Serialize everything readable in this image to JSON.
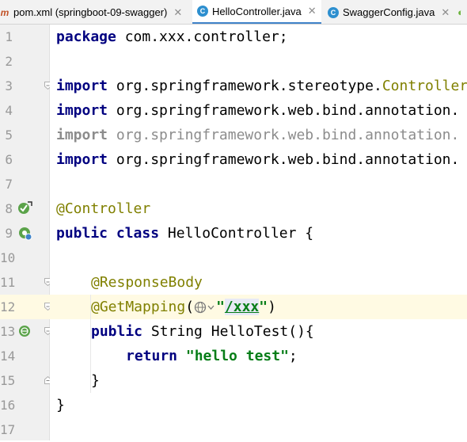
{
  "tabs": [
    {
      "label": "pom.xml (springboot-09-swagger)",
      "icon": "maven-icon",
      "active": false
    },
    {
      "label": "HelloController.java",
      "icon": "java-class-icon",
      "active": true
    },
    {
      "label": "SwaggerConfig.java",
      "icon": "java-class-icon",
      "active": false
    }
  ],
  "line_numbers": [
    "1",
    "2",
    "3",
    "4",
    "5",
    "6",
    "7",
    "8",
    "9",
    "10",
    "11",
    "12",
    "13",
    "14",
    "15",
    "16",
    "17"
  ],
  "code": {
    "l1_kw": "package",
    "l1_rest": " com.xxx.controller;",
    "l3_kw": "import",
    "l3_pkg": " org.springframework.stereotype.",
    "l3_cls": "Controller",
    "l4_kw": "import",
    "l4_pkg": " org.springframework.web.bind.annotation.",
    "l5_kw": "import",
    "l5_pkg": " org.springframework.web.bind.annotation.",
    "l6_kw": "import",
    "l6_pkg": " org.springframework.web.bind.annotation.",
    "l8_ann": "@Controller",
    "l9_kw1": "public",
    "l9_kw2": "class",
    "l9_rest": " HelloController {",
    "l11_ann": "@ResponseBody",
    "l12_ann": "@GetMapping",
    "l12_paren": "(",
    "l12_q1": "\"",
    "l12_url": "/xxx",
    "l12_q2": "\"",
    "l12_end": ")",
    "l13_kw": "public",
    "l13_rest": " String HelloTest(){",
    "l14_kw": "return",
    "l14_str": "\"hello test\"",
    "l14_end": ";",
    "l15": "}",
    "l16": "}"
  },
  "colors": {
    "keyword": "#000080",
    "annotation": "#808000",
    "string": "#067d17",
    "line_number": "#999999",
    "tab_active": "#4083c9"
  }
}
